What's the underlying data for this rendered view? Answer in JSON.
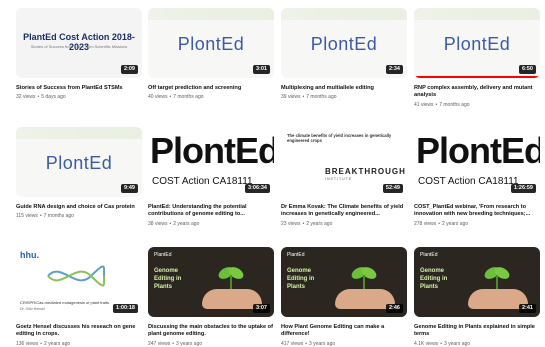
{
  "videos": [
    {
      "title": "Stories of Success from PlantEd STSMs",
      "views": "32 views",
      "age": "5 days ago",
      "duration": "2:09",
      "thumb": "cost",
      "thumb_title": "PlantEd Cost Action 2018-2023",
      "thumb_sub": "Stories of Success from Short Term Scientific Missions"
    },
    {
      "title": "Off target prediction and screening",
      "views": "40 views",
      "age": "7 months ago",
      "duration": "3:01",
      "thumb": "plonted",
      "thumb_title": "PlontEd"
    },
    {
      "title": "Multiplexing and multiallele editing",
      "views": "39 views",
      "age": "7 months ago",
      "duration": "2:34",
      "thumb": "plonted",
      "thumb_title": "PlontEd"
    },
    {
      "title": "RNP complex assembly, delivery and mutant analysis",
      "views": "41 views",
      "age": "7 months ago",
      "duration": "6:50",
      "thumb": "plonted",
      "thumb_title": "PlontEd",
      "progress": 1.0
    },
    {
      "title": "Guide RNA design and choice of Cas protein",
      "views": "115 views",
      "age": "7 months ago",
      "duration": "9:49",
      "thumb": "plonted",
      "thumb_title": "PlontEd"
    },
    {
      "title": "PlantEd: Understanding the potential contributions of genome editing to...",
      "views": "38 views",
      "age": "2 years ago",
      "duration": "3:06:34",
      "thumb": "big",
      "thumb_title": "PlontEd",
      "thumb_sub": "COST Action CA18111"
    },
    {
      "title": "Dr Emma Kovak: The Climate benefits of yield increases in genetically engineered...",
      "views": "23 views",
      "age": "2 years ago",
      "duration": "52:49",
      "thumb": "breakthrough",
      "thumb_title": "The climate benefits of yield increases in genetically engineered crops",
      "thumb_sub": "BREAKTHROUGH",
      "thumb_sub2": "INSTITUTE"
    },
    {
      "title": "COST_PlantEd webinar, 'From research to innovation with new breeding techniques;...",
      "views": "278 views",
      "age": "2 years ago",
      "duration": "1:26:59",
      "thumb": "big",
      "thumb_title": "PlontEd",
      "thumb_sub": "COST Action CA18111"
    },
    {
      "title": "Goetz Hensel discusses his reseach on gene editing in crops.",
      "views": "136 views",
      "age": "2 years ago",
      "duration": "1:00:18",
      "thumb": "hhu",
      "thumb_title": "hhu.",
      "thumb_sub": "CRISPR/Cas-mediated mutagenesis of plant traits",
      "thumb_sub2": "Dr. Götz Hensel"
    },
    {
      "title": "Discussing the main obstacles to the uptake of plant genome editing.",
      "views": "247 views",
      "age": "3 years ago",
      "duration": "3:07",
      "thumb": "soil",
      "thumb_title": "Genome Editing in Plants",
      "thumb_sub": "PlantEd"
    },
    {
      "title": "How Plant Genome Editing can make a difference!",
      "views": "417 views",
      "age": "3 years ago",
      "duration": "2:46",
      "thumb": "soil",
      "thumb_title": "Genome Editing in Plants",
      "thumb_sub": "PlantEd"
    },
    {
      "title": "Genome Editing in Plants explained in simple terms",
      "views": "4.1K views",
      "age": "3 years ago",
      "duration": "2:41",
      "thumb": "soil",
      "thumb_title": "Genome Editing in Plants",
      "thumb_sub": "PlantEd"
    }
  ],
  "colors": {
    "accent": "#ff0000",
    "plonted_blue": "#3c5aa6",
    "meta": "#606060"
  }
}
